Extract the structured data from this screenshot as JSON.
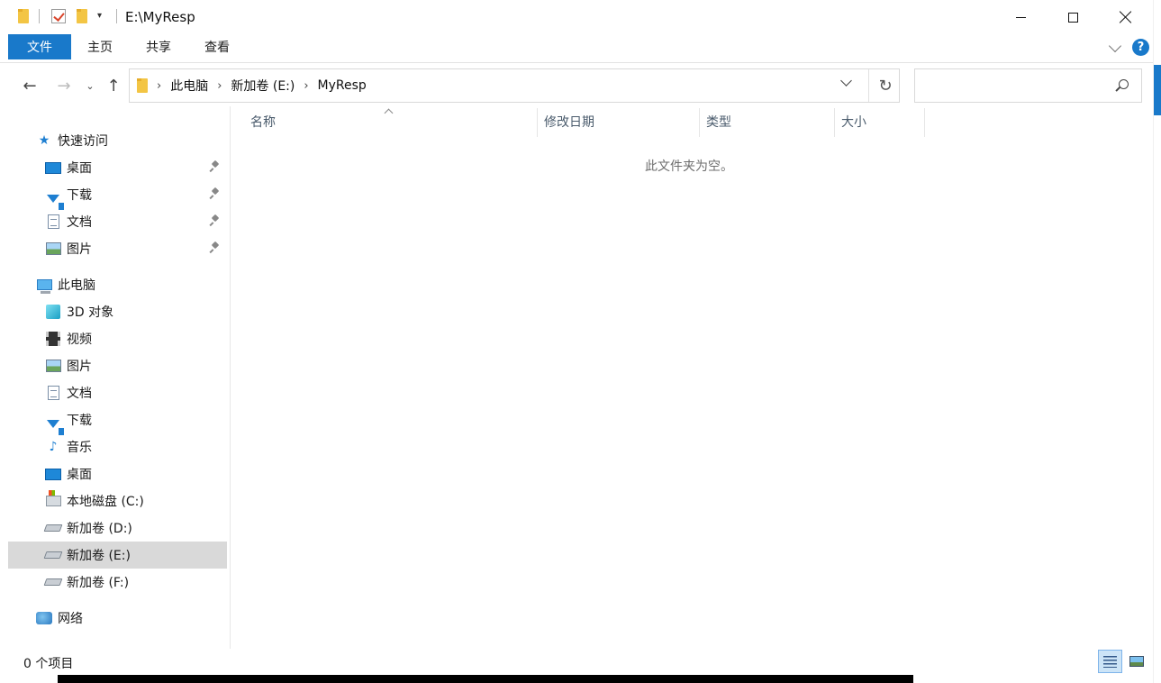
{
  "window": {
    "title": "E:\\MyResp"
  },
  "ribbon": {
    "tabs": [
      "文件",
      "主页",
      "共享",
      "查看"
    ],
    "help": "?"
  },
  "address": {
    "crumbs": [
      "此电脑",
      "新加卷 (E:)",
      "MyResp"
    ]
  },
  "search": {
    "placeholder": ""
  },
  "nav": {
    "quick_access": "快速访问",
    "quick_items": [
      "桌面",
      "下载",
      "文档",
      "图片"
    ],
    "this_pc": "此电脑",
    "pc_items": [
      "3D 对象",
      "视频",
      "图片",
      "文档",
      "下载",
      "音乐",
      "桌面",
      "本地磁盘 (C:)",
      "新加卷 (D:)",
      "新加卷 (E:)",
      "新加卷 (F:)"
    ],
    "network": "网络"
  },
  "columns": [
    "名称",
    "修改日期",
    "类型",
    "大小"
  ],
  "empty_message": "此文件夹为空。",
  "status": {
    "count": "0 个项目"
  },
  "colors": {
    "accent": "#1979ca",
    "selection": "#d9d9d9"
  }
}
